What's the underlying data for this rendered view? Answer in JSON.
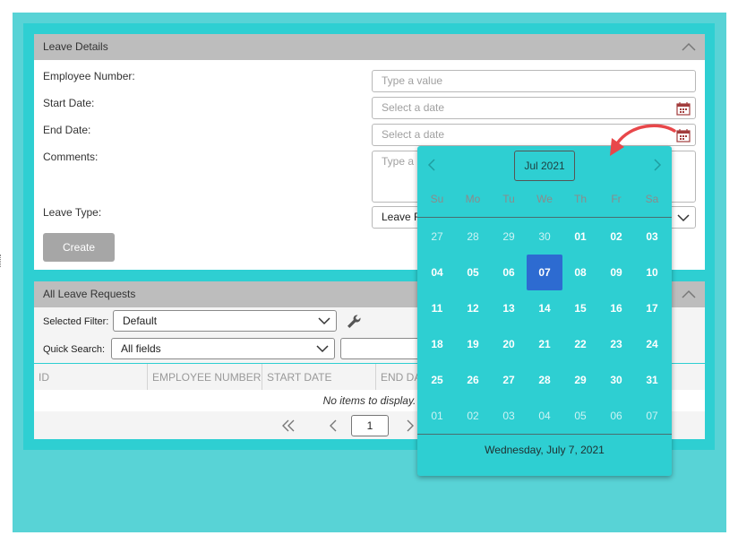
{
  "leave_details": {
    "title": "Leave Details",
    "employee_number": {
      "label": "Employee Number:",
      "placeholder": "Type a value"
    },
    "start_date": {
      "label": "Start Date:",
      "placeholder": "Select a date"
    },
    "end_date": {
      "label": "End Date:",
      "placeholder": "Select a date"
    },
    "comments": {
      "label": "Comments:",
      "placeholder": "Type a"
    },
    "leave_type": {
      "label": "Leave Type:",
      "value": "Leave F"
    },
    "create_button": "Create"
  },
  "requests": {
    "title": "All Leave Requests",
    "selected_filter": {
      "label": "Selected Filter:",
      "value": "Default"
    },
    "quick_search": {
      "label": "Quick Search:",
      "value": "All fields"
    },
    "columns": [
      "ID",
      "EMPLOYEE NUMBER",
      "START DATE",
      "END DA"
    ],
    "empty_message": "No items to display.",
    "page": "1"
  },
  "calendar": {
    "title": "Jul 2021",
    "weekdays": [
      "Su",
      "Mo",
      "Tu",
      "We",
      "Th",
      "Fr",
      "Sa"
    ],
    "weeks": [
      [
        "27",
        "28",
        "29",
        "30",
        "01",
        "02",
        "03"
      ],
      [
        "04",
        "05",
        "06",
        "07",
        "08",
        "09",
        "10"
      ],
      [
        "11",
        "12",
        "13",
        "14",
        "15",
        "16",
        "17"
      ],
      [
        "18",
        "19",
        "20",
        "21",
        "22",
        "23",
        "24"
      ],
      [
        "25",
        "26",
        "27",
        "28",
        "29",
        "30",
        "31"
      ],
      [
        "01",
        "02",
        "03",
        "04",
        "05",
        "06",
        "07"
      ]
    ],
    "selected_day": "07",
    "footer": "Wednesday, July 7, 2021"
  },
  "colors": {
    "outer_bg": "#58d3d6",
    "frame_bg": "#2ecfd2",
    "panel_header": "#bdbdbd",
    "selected_day": "#2d6bd1",
    "annotation_arrow": "#e8474a",
    "calendar_icon": "#a23c3c"
  }
}
